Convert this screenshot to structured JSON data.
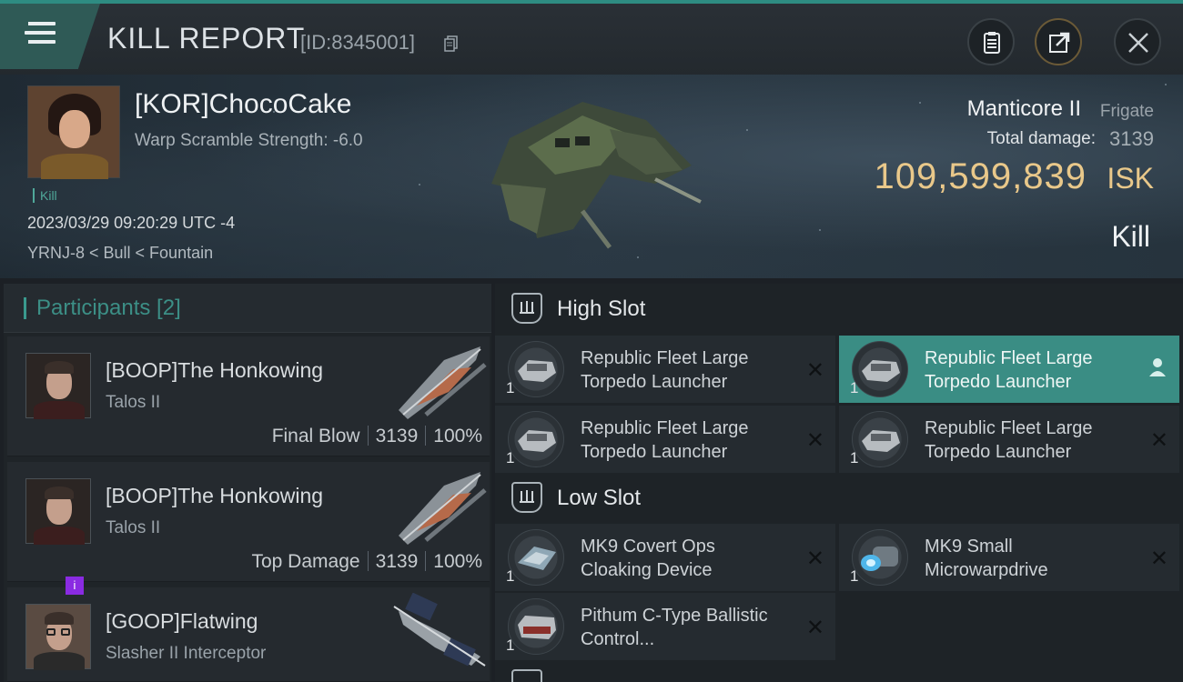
{
  "header": {
    "title": "KILL REPORT",
    "report_id": "[ID:8345001]"
  },
  "victim": {
    "name": "[KOR]ChocoCake",
    "subtitle": "Warp Scramble Strength: -6.0",
    "tag": "Kill",
    "timestamp": "2023/03/29 09:20:29 UTC -4",
    "location": "YRNJ-8 < Bull < Fountain",
    "ship_name": "Manticore II",
    "ship_class": "Frigate",
    "total_damage_label": "Total damage:",
    "total_damage": "3139",
    "isk_value": "109,599,839",
    "isk_unit": "ISK",
    "result": "Kill"
  },
  "participants": {
    "title": "Participants [2]",
    "items": [
      {
        "name": "[BOOP]The Honkowing",
        "ship": "Talos II",
        "role": "Final Blow",
        "damage": "3139",
        "percent": "100%"
      },
      {
        "name": "[BOOP]The Honkowing",
        "ship": "Talos II",
        "role": "Top Damage",
        "damage": "3139",
        "percent": "100%"
      },
      {
        "name": "[GOOP]Flatwing",
        "ship": "Slasher II Interceptor",
        "badge": "i"
      }
    ]
  },
  "fitting": {
    "high_slot": {
      "title": "High Slot",
      "modules": [
        {
          "name": "Republic Fleet Large Torpedo Launcher",
          "qty": "1"
        },
        {
          "name": "Republic Fleet Large Torpedo Launcher",
          "qty": "1"
        },
        {
          "name": "Republic Fleet Large Torpedo Launcher",
          "qty": "1"
        },
        {
          "name": "Republic Fleet Large Torpedo Launcher",
          "qty": "1"
        }
      ]
    },
    "low_slot": {
      "title": "Low Slot",
      "modules": [
        {
          "name": "MK9 Covert Ops Cloaking Device",
          "qty": "1"
        },
        {
          "name": "MK9 Small Microwarpdrive",
          "qty": "1"
        },
        {
          "name": "Pithum C-Type Ballistic Control...",
          "qty": "1"
        }
      ]
    }
  },
  "colors": {
    "accent": "#3a8d84",
    "isk": "#e9c88a",
    "badge": "#8a2be2"
  },
  "icons": [
    "menu-icon",
    "copy-icon",
    "clipboard-icon",
    "share-icon",
    "close-icon",
    "high-slot-icon",
    "low-slot-icon",
    "remove-icon",
    "user-icon"
  ]
}
